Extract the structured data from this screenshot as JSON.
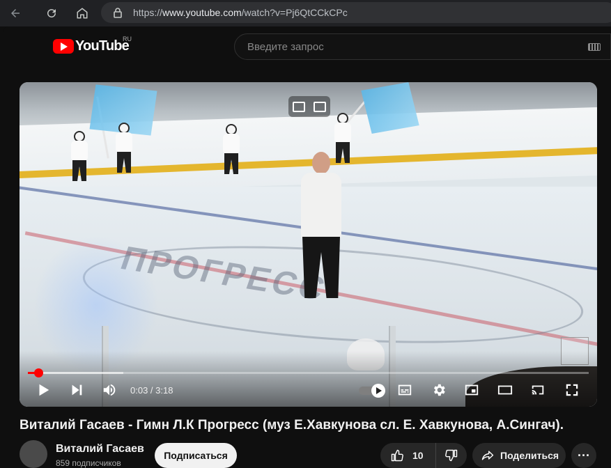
{
  "browser": {
    "url_prefix": "https://",
    "url_domain": "www.youtube.com",
    "url_path": "/watch?v=Pj6QtCCkCPc"
  },
  "header": {
    "logo_text": "YouTube",
    "region": "RU",
    "search_placeholder": "Введите запрос"
  },
  "player": {
    "current_time": "0:03",
    "separator": " / ",
    "duration": "3:18",
    "progress_fraction": 0.019,
    "buffered_fraction": 0.17,
    "ice_logo_text": "ПРОГРЕСС",
    "autoplay_on": true
  },
  "video": {
    "title": "Виталий Гасаев - Гимн Л.К Прогресс (муз Е.Хавкунова сл. Е. Хавкунова, А.Сингач).",
    "channel_name": "Виталий Гасаев",
    "subscribers": "859 подписчиков",
    "subscribe_label": "Подписаться",
    "like_count": "10",
    "share_label": "Поделиться",
    "more_label": "···"
  },
  "colors": {
    "accent": "#ff0000",
    "background": "#0f0f0f"
  }
}
